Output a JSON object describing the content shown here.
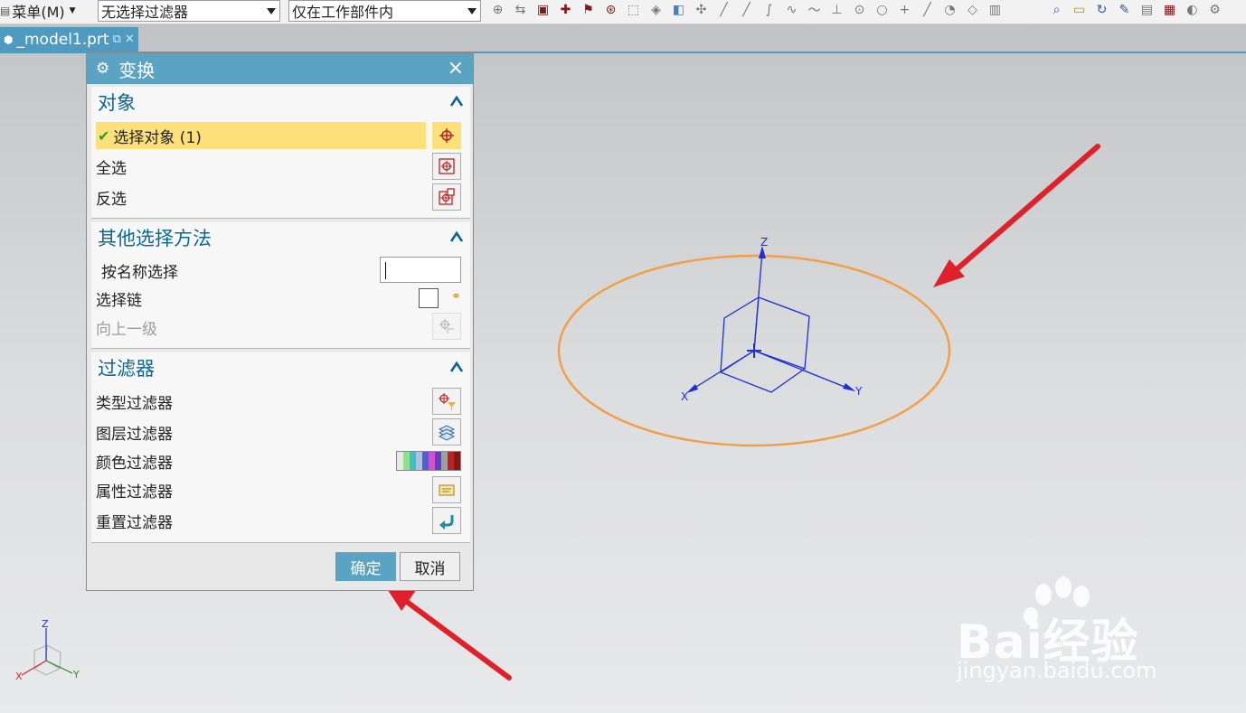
{
  "toolbar": {
    "menu_label": "菜单(M)",
    "filter_value": "无选择过滤器",
    "scope_value": "仅在工作部件内"
  },
  "tab": {
    "label": "_model1.prt"
  },
  "dialog": {
    "title": "变换",
    "object_section": {
      "heading": "对象",
      "select_object": "选择对象 (1)",
      "select_all": "全选",
      "invert": "反选"
    },
    "other_section": {
      "heading": "其他选择方法",
      "by_name": "按名称选择",
      "chain": "选择链",
      "up_level": "向上一级"
    },
    "filter_section": {
      "heading": "过滤器",
      "type": "类型过滤器",
      "layer": "图层过滤器",
      "color": "颜色过滤器",
      "attribute": "属性过滤器",
      "reset": "重置过滤器"
    },
    "ok_label": "确定",
    "cancel_label": "取消"
  },
  "viewport": {
    "axis_x": "X",
    "axis_y": "Y",
    "axis_z": "Z",
    "ellipse_color": "#f0a04a",
    "csys_color": "#1c2fd8",
    "arrow_color": "#e0202a"
  },
  "watermark": {
    "brand": "Bai经验",
    "url": "jingyan.baidu.com"
  }
}
